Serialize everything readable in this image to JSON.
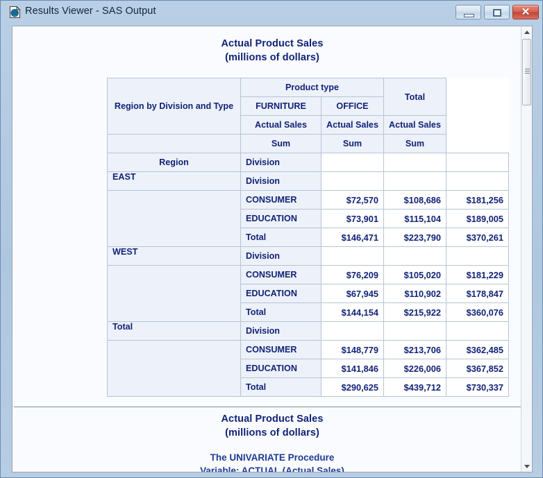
{
  "window": {
    "title": "Results Viewer - SAS Output",
    "icon": "sas-output-document-icon",
    "controls": {
      "minimize_label": "–",
      "maximize_label": "□",
      "close_label": "✕"
    }
  },
  "scrollbar": {
    "up_label": "scroll-up",
    "down_label": "scroll-down",
    "thumb_label": "scroll-thumb"
  },
  "report": {
    "title_line1": "Actual Product Sales",
    "title_line2": "(millions of dollars)"
  },
  "table": {
    "stub_label": "Region by Division and Type",
    "spanner": "Product type",
    "total_spanner": "Total",
    "product_types": [
      "FURNITURE",
      "OFFICE"
    ],
    "measure_label": "Actual Sales",
    "statistic_label": "Sum",
    "row_header_region": "Region",
    "row_header_division": "Division",
    "rows": [
      {
        "region": "EAST",
        "division": "Division",
        "furniture": "",
        "office": "",
        "total": ""
      },
      {
        "region": "",
        "division": "CONSUMER",
        "furniture": "$72,570",
        "office": "$108,686",
        "total": "$181,256"
      },
      {
        "region": "",
        "division": "EDUCATION",
        "furniture": "$73,901",
        "office": "$115,104",
        "total": "$189,005"
      },
      {
        "region": "",
        "division": "Total",
        "furniture": "$146,471",
        "office": "$223,790",
        "total": "$370,261"
      },
      {
        "region": "WEST",
        "division": "Division",
        "furniture": "",
        "office": "",
        "total": ""
      },
      {
        "region": "",
        "division": "CONSUMER",
        "furniture": "$76,209",
        "office": "$105,020",
        "total": "$181,229"
      },
      {
        "region": "",
        "division": "EDUCATION",
        "furniture": "$67,945",
        "office": "$110,902",
        "total": "$178,847"
      },
      {
        "region": "",
        "division": "Total",
        "furniture": "$144,154",
        "office": "$215,922",
        "total": "$360,076"
      },
      {
        "region": "Total",
        "division": "Division",
        "furniture": "",
        "office": "",
        "total": ""
      },
      {
        "region": "",
        "division": "CONSUMER",
        "furniture": "$148,779",
        "office": "$213,706",
        "total": "$362,485"
      },
      {
        "region": "",
        "division": "EDUCATION",
        "furniture": "$141,846",
        "office": "$226,006",
        "total": "$367,852"
      },
      {
        "region": "",
        "division": "Total",
        "furniture": "$290,625",
        "office": "$439,712",
        "total": "$730,337"
      }
    ]
  },
  "page2": {
    "title_line1": "Actual Product Sales",
    "title_line2": "(millions of dollars)",
    "procedure": "The UNIVARIATE Procedure",
    "variable_line": "Variable: ACTUAL (Actual Sales)"
  },
  "colors": {
    "report_title": "#112277",
    "table_header_bg": "#edf1f9",
    "table_border": "#b6c4d4",
    "titlebar_start": "#b9cfe5",
    "close_button": "#bf4535"
  }
}
